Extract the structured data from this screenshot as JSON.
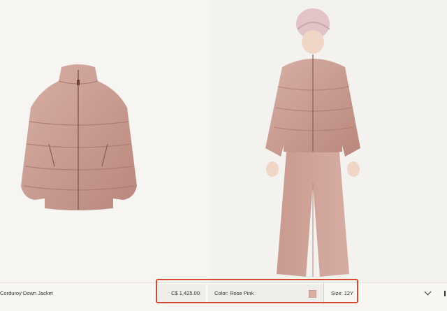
{
  "product": {
    "name": "Corduroy Down Jacket",
    "price": "C$ 1,425.00",
    "color_label": "Color: Rose Pink",
    "color_hex": "#d6aea4",
    "size_label": "Size: 12Y"
  },
  "icons": {
    "size_dropdown": "chevron-down-icon"
  },
  "colors": {
    "background": "#f5f4f1",
    "highlight": "#d34a34",
    "jacket": "#c99a8f"
  }
}
